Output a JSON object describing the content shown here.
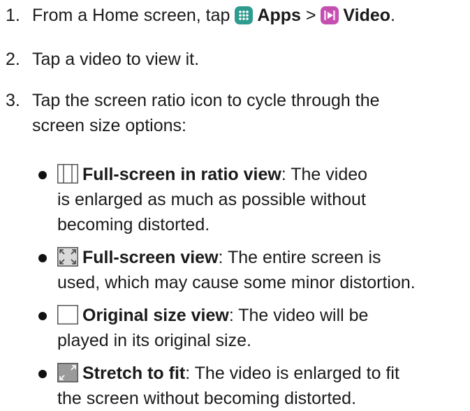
{
  "steps": [
    {
      "number": "1.",
      "pre": "From a Home screen, tap",
      "apps_label": "Apps",
      "separator": ">",
      "video_label": "Video",
      "end": "."
    },
    {
      "number": "2.",
      "text": "Tap a video to view it."
    },
    {
      "number": "3.",
      "lines": [
        "Tap the screen ratio icon to cycle through the",
        "screen size options:"
      ]
    }
  ],
  "options": [
    {
      "icon": "ratio-view-icon",
      "title": "Full-screen in ratio view",
      "first_line_rest": ": The video",
      "lines": [
        "is enlarged as much as possible without",
        "becoming distorted."
      ]
    },
    {
      "icon": "full-screen-icon",
      "title": "Full-screen view",
      "first_line_rest": ": The entire screen is",
      "lines": [
        "used, which may cause some minor distortion."
      ]
    },
    {
      "icon": "original-size-icon",
      "title": "Original size view",
      "first_line_rest": ": The video will be",
      "lines": [
        "played in its original size."
      ]
    },
    {
      "icon": "stretch-to-fit-icon",
      "title": "Stretch to fit",
      "first_line_rest": ": The video is enlarged to fit",
      "lines": [
        "the screen without becoming distorted."
      ]
    }
  ],
  "colors": {
    "apps_icon": "#2e9b8f",
    "video_icon": "#c44fb0",
    "icon_frame": "#555555"
  }
}
